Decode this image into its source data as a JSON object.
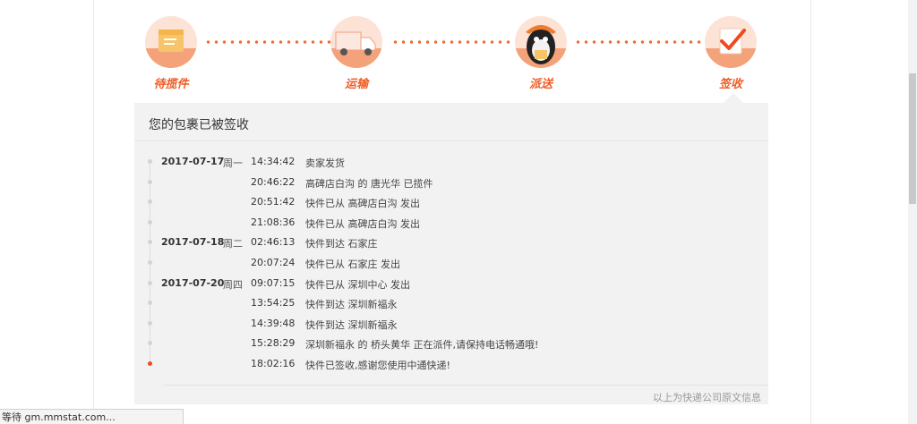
{
  "steps": [
    {
      "label": "待揽件",
      "icon": "package-icon"
    },
    {
      "label": "运输",
      "icon": "truck-icon"
    },
    {
      "label": "派送",
      "icon": "courier-icon"
    },
    {
      "label": "签收",
      "icon": "signed-check-icon"
    }
  ],
  "panel": {
    "title": "您的包裹已被签收",
    "footer_note": "以上为快递公司原文信息"
  },
  "events": [
    {
      "date": "2017-07-17",
      "weekday": "周一",
      "time": "14:34:42",
      "desc": "卖家发货"
    },
    {
      "date": "",
      "weekday": "",
      "time": "20:46:22",
      "desc": "高碑店白沟 的 唐光华 已揽件"
    },
    {
      "date": "",
      "weekday": "",
      "time": "20:51:42",
      "desc": "快件已从 高碑店白沟 发出"
    },
    {
      "date": "",
      "weekday": "",
      "time": "21:08:36",
      "desc": "快件已从 高碑店白沟 发出"
    },
    {
      "date": "2017-07-18",
      "weekday": "周二",
      "time": "02:46:13",
      "desc": "快件到达 石家庄"
    },
    {
      "date": "",
      "weekday": "",
      "time": "20:07:24",
      "desc": "快件已从 石家庄 发出"
    },
    {
      "date": "2017-07-20",
      "weekday": "周四",
      "time": "09:07:15",
      "desc": "快件已从 深圳中心 发出"
    },
    {
      "date": "",
      "weekday": "",
      "time": "13:54:25",
      "desc": "快件到达 深圳新福永"
    },
    {
      "date": "",
      "weekday": "",
      "time": "14:39:48",
      "desc": "快件到达 深圳新福永"
    },
    {
      "date": "",
      "weekday": "",
      "time": "15:28:29",
      "desc": "深圳新福永 的 桥头黄华 正在派件,请保持电话畅通哦!"
    },
    {
      "date": "",
      "weekday": "",
      "time": "18:02:16",
      "desc": "快件已签收,感谢您使用中通快递!"
    }
  ],
  "status_bar": {
    "text": "等待 gm.mmstat.com..."
  },
  "colors": {
    "accent": "#ee5c25",
    "panel_bg": "#f2f2f2"
  }
}
